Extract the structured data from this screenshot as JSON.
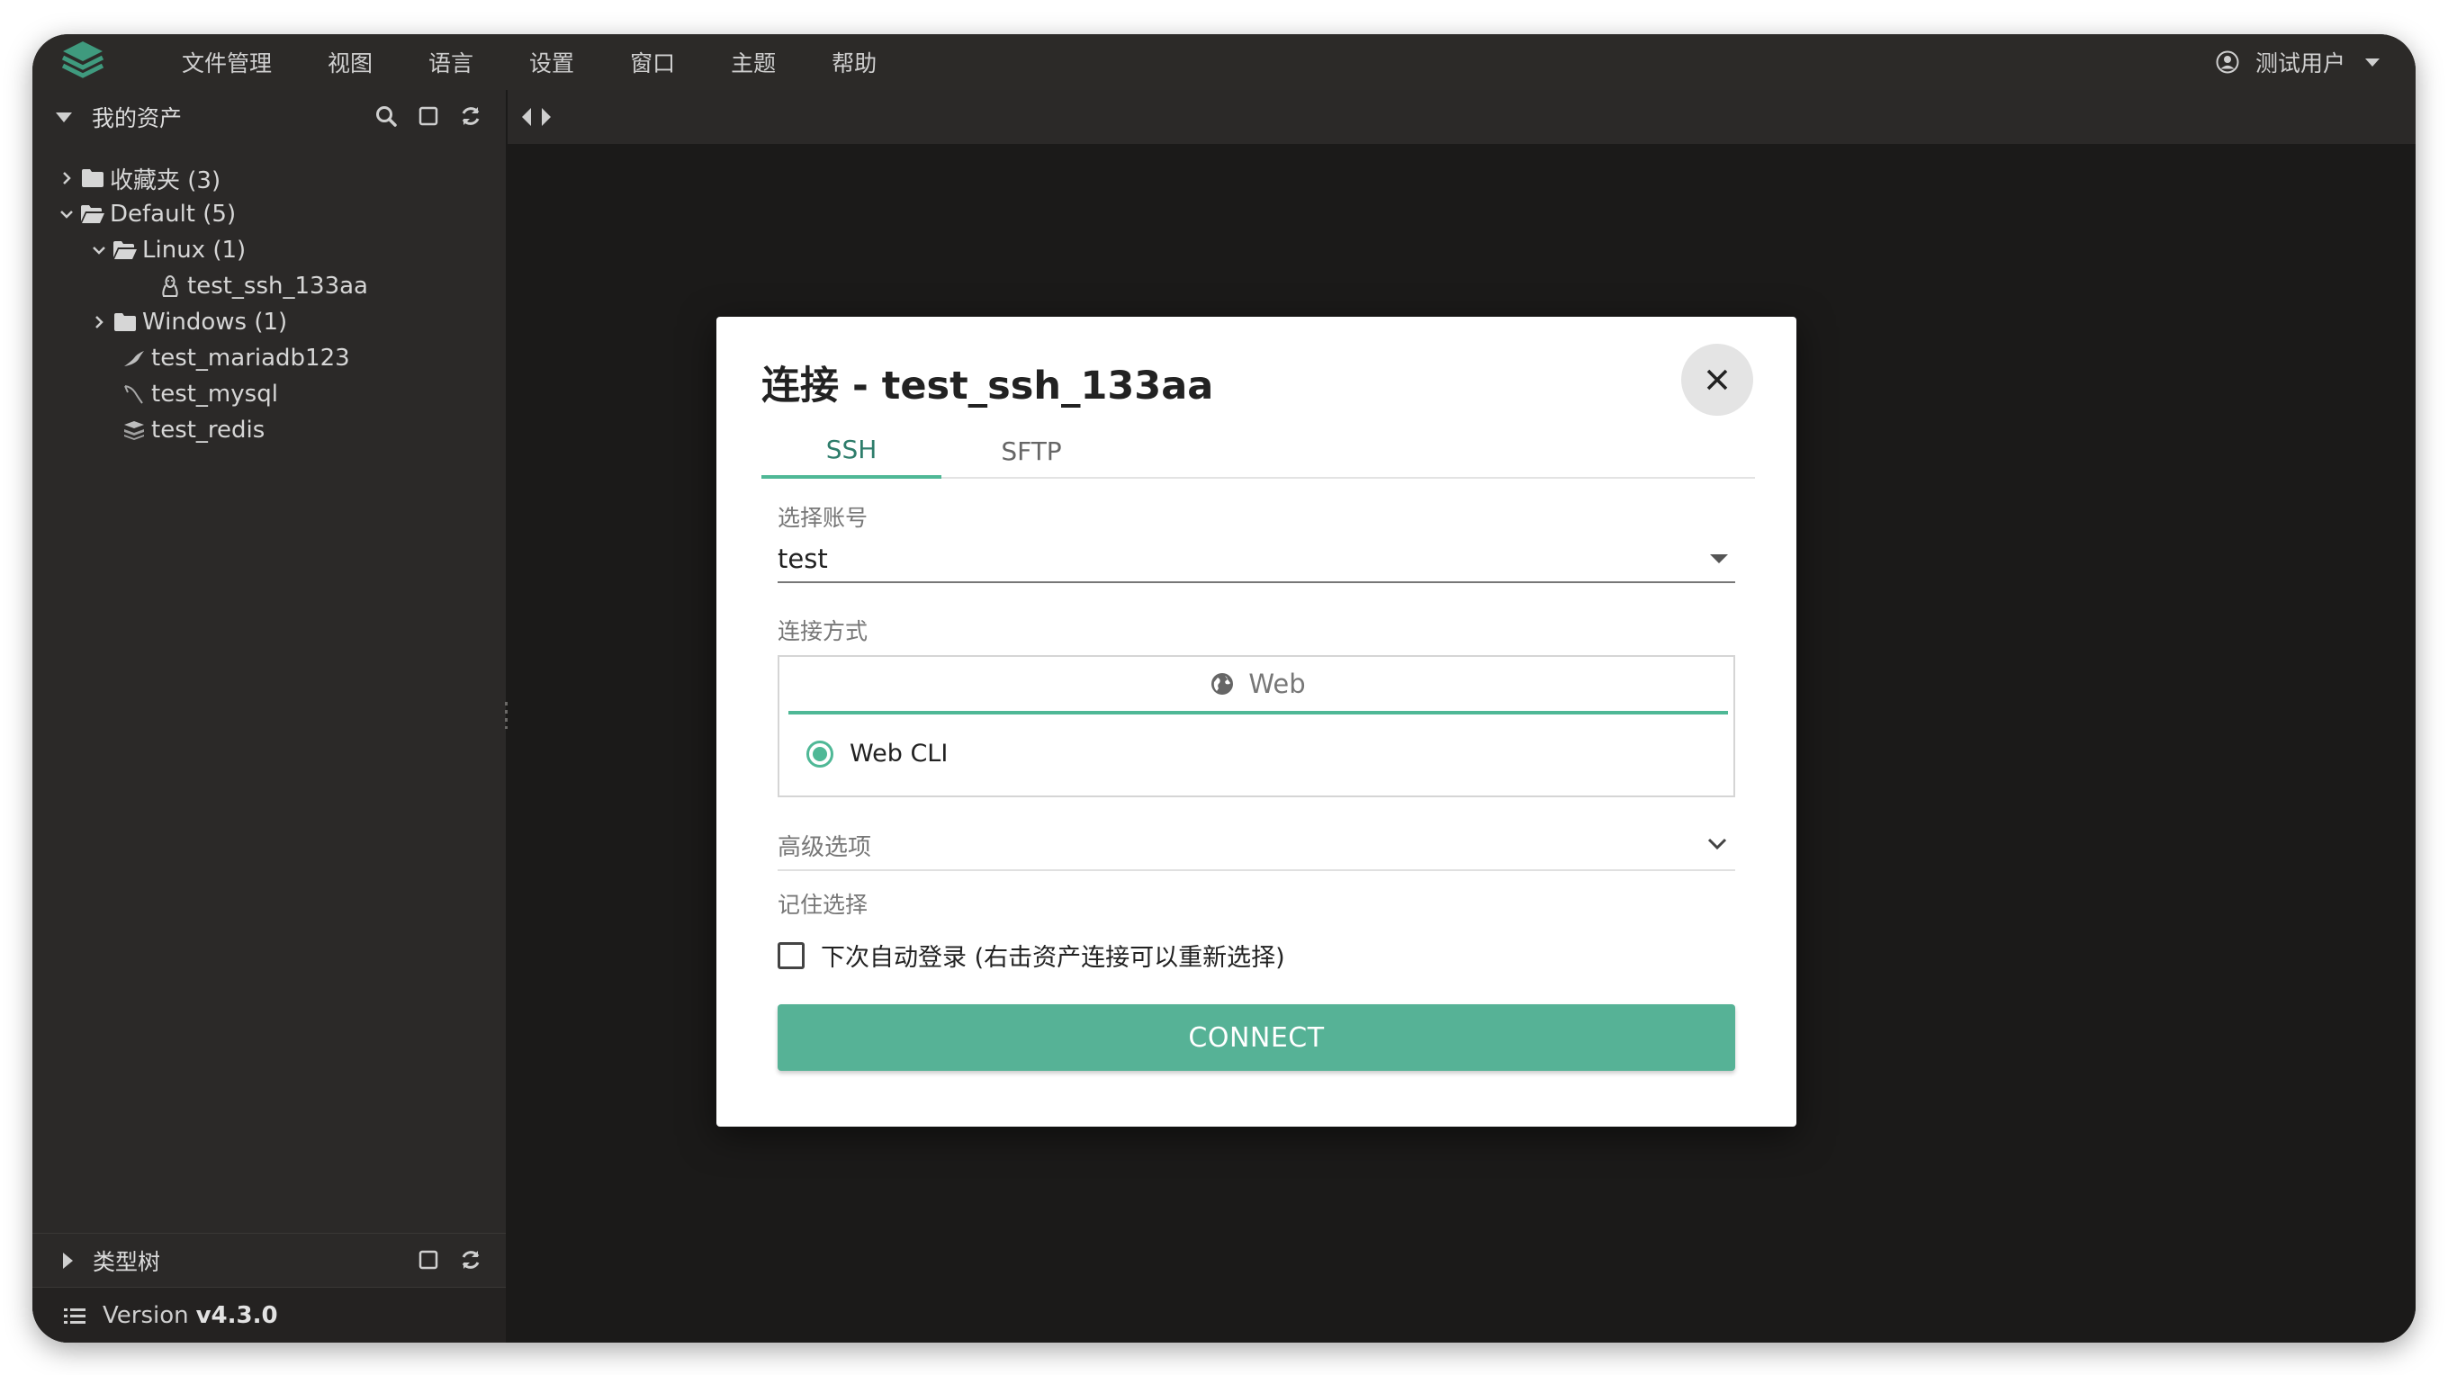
{
  "menubar": {
    "items": [
      "文件管理",
      "视图",
      "语言",
      "设置",
      "窗口",
      "主题",
      "帮助"
    ],
    "user_name": "测试用户"
  },
  "sidebar": {
    "title": "我的资产",
    "tree": {
      "favorites": "收藏夹 (3)",
      "default": "Default (5)",
      "linux": "Linux (1)",
      "ssh_asset": "test_ssh_133aa",
      "windows": "Windows (1)",
      "mariadb": "test_mariadb123",
      "mysql": "test_mysql",
      "redis": "test_redis"
    },
    "type_tree_label": "类型树",
    "version_label": "Version",
    "version_value": "v4.3.0"
  },
  "dialog": {
    "title": "连接 - test_ssh_133aa",
    "tabs": [
      "SSH",
      "SFTP"
    ],
    "account_label": "选择账号",
    "account_value": "test",
    "method_label": "连接方式",
    "method_tab": "Web",
    "method_option": "Web CLI",
    "advanced_label": "高级选项",
    "remember_label": "记住选择",
    "auto_login_label": "下次自动登录 (右击资产连接可以重新选择)",
    "connect_button": "CONNECT"
  },
  "colors": {
    "accent": "#56b296",
    "background": "#1b1a19",
    "panel": "#2b2928",
    "menubar": "#2c2a28"
  }
}
